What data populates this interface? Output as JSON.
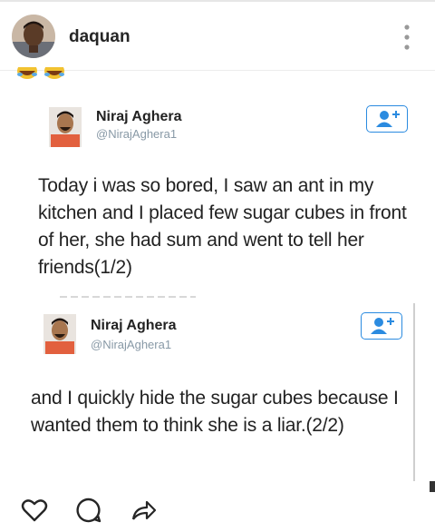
{
  "post": {
    "username": "daquan",
    "avatar_icon": "user-photo-avatar"
  },
  "tweets": [
    {
      "name": "Niraj Aghera",
      "handle": "@NirajAghera1",
      "text": "Today i was so bored, I saw an ant in my kitchen and I placed few sugar cubes in front of her, she had sum and went to tell her friends(1/2)"
    },
    {
      "name": "Niraj Aghera",
      "handle": "@NirajAghera1",
      "text": "and I quickly hide the sugar cubes because I wanted them to think she is a liar.(2/2)"
    }
  ],
  "actions": {
    "like_icon": "heart-icon",
    "comment_icon": "comment-icon",
    "share_icon": "share-icon"
  },
  "colors": {
    "follow_blue": "#2b8be0",
    "handle_gray": "#8899a6"
  }
}
